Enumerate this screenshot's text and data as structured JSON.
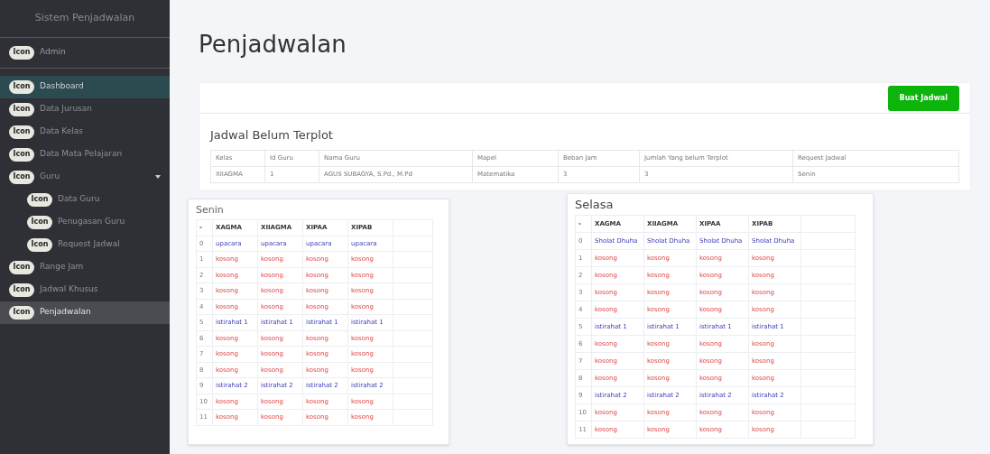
{
  "sidebar": {
    "brand": "Sistem Penjadwalan",
    "user": {
      "icon_label": "Icon",
      "name": "Admin"
    },
    "items": [
      {
        "icon_label": "Icon",
        "label": "Dashboard",
        "selected": false,
        "highlighted": true
      },
      {
        "icon_label": "Icon",
        "label": "Data Jurusan",
        "selected": false,
        "highlighted": false
      },
      {
        "icon_label": "Icon",
        "label": "Data Kelas",
        "selected": false,
        "highlighted": false
      },
      {
        "icon_label": "Icon",
        "label": "Data Mata Pelajaran",
        "selected": false,
        "highlighted": false
      },
      {
        "icon_label": "Icon",
        "label": "Guru",
        "selected": false,
        "highlighted": false,
        "expanded": true,
        "children": [
          {
            "icon_label": "Icon",
            "label": "Data Guru",
            "selected": false,
            "highlighted": false
          },
          {
            "icon_label": "Icon",
            "label": "Penugasan Guru",
            "selected": false,
            "highlighted": false
          },
          {
            "icon_label": "Icon",
            "label": "Request Jadwal",
            "selected": false,
            "highlighted": false
          }
        ]
      },
      {
        "icon_label": "Icon",
        "label": "Range Jam",
        "selected": false,
        "highlighted": false
      },
      {
        "icon_label": "Icon",
        "label": "Jadwal Khusus",
        "selected": false,
        "highlighted": false
      },
      {
        "icon_label": "Icon",
        "label": "Penjadwalan",
        "selected": true,
        "highlighted": false
      }
    ]
  },
  "page_title": "Penjadwalan",
  "create_button": "Buat Jadwal",
  "unplotted": {
    "title": "Jadwal Belum Terplot",
    "columns": [
      "Kelas",
      "Id Guru",
      "Nama Guru",
      "Mapel",
      "Beban Jam",
      "Jumlah Yang belum Terplot",
      "Request Jadwal"
    ],
    "rows": [
      [
        "XIIAGMA",
        "1",
        "AGUS SUBAGYA, S.Pd., M.Pd",
        "Matematika",
        "3",
        "3",
        "Senin"
      ]
    ]
  },
  "days": [
    {
      "title": "Senin",
      "columns": [
        "-",
        "XAGMA",
        "XIIAGMA",
        "XIPAA",
        "XIPAB"
      ],
      "rows": [
        {
          "kind": "activity",
          "cells": [
            "0",
            "upacara",
            "upacara",
            "upacara",
            "upacara"
          ]
        },
        {
          "kind": "empty",
          "cells": [
            "1",
            "kosong",
            "kosong",
            "kosong",
            "kosong"
          ]
        },
        {
          "kind": "empty",
          "cells": [
            "2",
            "kosong",
            "kosong",
            "kosong",
            "kosong"
          ]
        },
        {
          "kind": "empty",
          "cells": [
            "3",
            "kosong",
            "kosong",
            "kosong",
            "kosong"
          ]
        },
        {
          "kind": "empty",
          "cells": [
            "4",
            "kosong",
            "kosong",
            "kosong",
            "kosong"
          ]
        },
        {
          "kind": "activity",
          "cells": [
            "5",
            "istirahat 1",
            "istirahat 1",
            "istirahat 1",
            "istirahat 1"
          ]
        },
        {
          "kind": "empty",
          "cells": [
            "6",
            "kosong",
            "kosong",
            "kosong",
            "kosong"
          ]
        },
        {
          "kind": "empty",
          "cells": [
            "7",
            "kosong",
            "kosong",
            "kosong",
            "kosong"
          ]
        },
        {
          "kind": "empty",
          "cells": [
            "8",
            "kosong",
            "kosong",
            "kosong",
            "kosong"
          ]
        },
        {
          "kind": "activity",
          "cells": [
            "9",
            "istirahat 2",
            "istirahat 2",
            "istirahat 2",
            "istirahat 2"
          ]
        },
        {
          "kind": "empty",
          "cells": [
            "10",
            "kosong",
            "kosong",
            "kosong",
            "kosong"
          ]
        },
        {
          "kind": "empty",
          "cells": [
            "11",
            "kosong",
            "kosong",
            "kosong",
            "kosong"
          ]
        }
      ]
    },
    {
      "title": "Selasa",
      "columns": [
        "-",
        "XAGMA",
        "XIIAGMA",
        "XIPAA",
        "XIPAB"
      ],
      "rows": [
        {
          "kind": "activity",
          "cells": [
            "0",
            "Sholat Dhuha",
            "Sholat Dhuha",
            "Sholat Dhuha",
            "Sholat Dhuha"
          ]
        },
        {
          "kind": "empty",
          "cells": [
            "1",
            "kosong",
            "kosong",
            "kosong",
            "kosong"
          ]
        },
        {
          "kind": "empty",
          "cells": [
            "2",
            "kosong",
            "kosong",
            "kosong",
            "kosong"
          ]
        },
        {
          "kind": "empty",
          "cells": [
            "3",
            "kosong",
            "kosong",
            "kosong",
            "kosong"
          ]
        },
        {
          "kind": "empty",
          "cells": [
            "4",
            "kosong",
            "kosong",
            "kosong",
            "kosong"
          ]
        },
        {
          "kind": "activity",
          "cells": [
            "5",
            "istirahat 1",
            "istirahat 1",
            "istirahat 1",
            "istirahat 1"
          ]
        },
        {
          "kind": "empty",
          "cells": [
            "6",
            "kosong",
            "kosong",
            "kosong",
            "kosong"
          ]
        },
        {
          "kind": "empty",
          "cells": [
            "7",
            "kosong",
            "kosong",
            "kosong",
            "kosong"
          ]
        },
        {
          "kind": "empty",
          "cells": [
            "8",
            "kosong",
            "kosong",
            "kosong",
            "kosong"
          ]
        },
        {
          "kind": "activity",
          "cells": [
            "9",
            "istirahat 2",
            "istirahat 2",
            "istirahat 2",
            "istirahat 2"
          ]
        },
        {
          "kind": "empty",
          "cells": [
            "10",
            "kosong",
            "kosong",
            "kosong",
            "kosong"
          ]
        },
        {
          "kind": "empty",
          "cells": [
            "11",
            "kosong",
            "kosong",
            "kosong",
            "kosong"
          ]
        }
      ]
    }
  ]
}
